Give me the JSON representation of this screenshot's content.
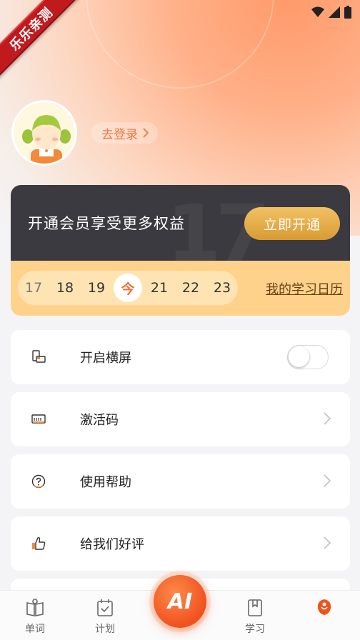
{
  "ribbon": {
    "text": "乐乐亲测"
  },
  "profile": {
    "login_label": "去登录"
  },
  "vip": {
    "promo_text": "开通会员享受更多权益",
    "open_button": "立即开通",
    "watermark": "17"
  },
  "calendar": {
    "days": [
      "17",
      "18",
      "19",
      "今",
      "21",
      "22",
      "23"
    ],
    "today_label": "今",
    "link_label": "我的学习日历"
  },
  "settings": {
    "landscape": {
      "label": "开启横屏",
      "enabled": false
    },
    "activation": {
      "label": "激活码"
    },
    "help": {
      "label": "使用帮助"
    },
    "review": {
      "label": "给我们好评"
    }
  },
  "nav": {
    "words": "单词",
    "plan": "计划",
    "ai": "AI",
    "study": "学习"
  },
  "colors": {
    "accent": "#f0521e",
    "gold": "#e2a843",
    "dark_card": "#3a3a40",
    "calendar_bg": "#ffd28c"
  }
}
